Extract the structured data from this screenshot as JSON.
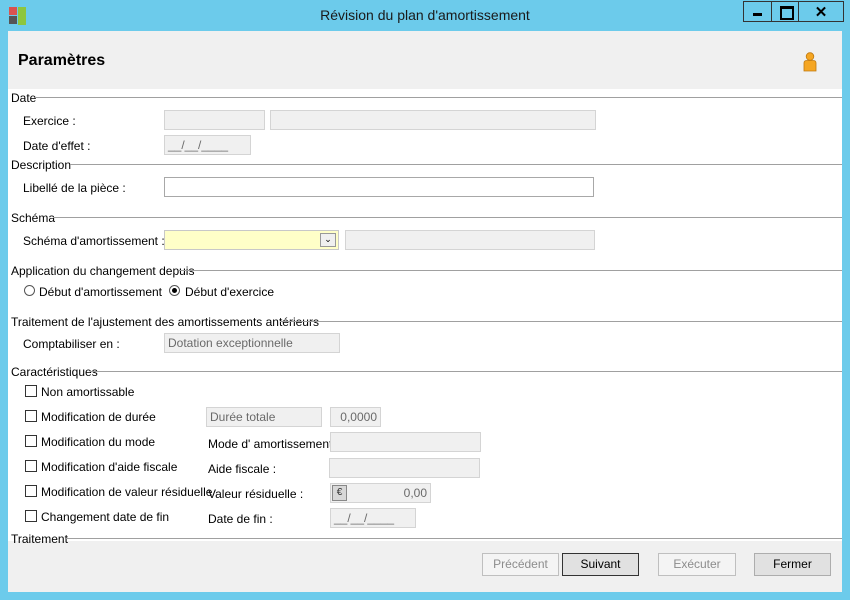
{
  "window": {
    "title": "Révision du plan d'amortissement"
  },
  "header": {
    "title": "Paramètres"
  },
  "sections": {
    "date": "Date",
    "description": "Description",
    "schema": "Schéma",
    "application": "Application du changement depuis",
    "traitement_ajustement": "Traitement de l'ajustement des amortissements antérieurs",
    "caracteristiques": "Caractéristiques",
    "traitement": "Traitement"
  },
  "fields": {
    "exercice_label": "Exercice :",
    "exercice_value": "",
    "exercice_desc": "",
    "date_effet_label": "Date d'effet :",
    "date_effet_value": "__/__/____",
    "libelle_label": "Libellé de la pièce :",
    "libelle_value": "",
    "schema_label": "Schéma d'amortissement :",
    "schema_value": "",
    "schema_desc": "",
    "comptabiliser_label": "Comptabiliser en :",
    "comptabiliser_value": "Dotation exceptionnelle"
  },
  "radios": {
    "debut_amortissement": "Début d'amortissement",
    "debut_exercice": "Début d'exercice"
  },
  "characteristics": {
    "non_amortissable": "Non amortissable",
    "modif_duree": "Modification de durée",
    "modif_mode": "Modification du mode",
    "modif_aide": "Modification d'aide fiscale",
    "modif_valeur": "Modification de valeur résiduelle",
    "changement_date": "Changement date de fin",
    "duree_totale": "Durée totale",
    "duree_value": "0,0000",
    "mode_label": "Mode d' amortissement :",
    "mode_value": "",
    "aide_label": "Aide fiscale :",
    "aide_value": "",
    "valeur_label": "Valeur résiduelle :",
    "valeur_value": "0,00",
    "euro_symbol": "€",
    "date_fin_label": "Date de fin :",
    "date_fin_value": "__/__/____"
  },
  "buttons": {
    "precedent": "Précédent",
    "suivant": "Suivant",
    "executer": "Exécuter",
    "fermer": "Fermer"
  },
  "titlebar": {
    "close_glyph": "✕"
  },
  "colors": {
    "titlebar": "#6ccbeb",
    "schema_field": "#ffffc8",
    "person_icon": "#f5a623"
  }
}
